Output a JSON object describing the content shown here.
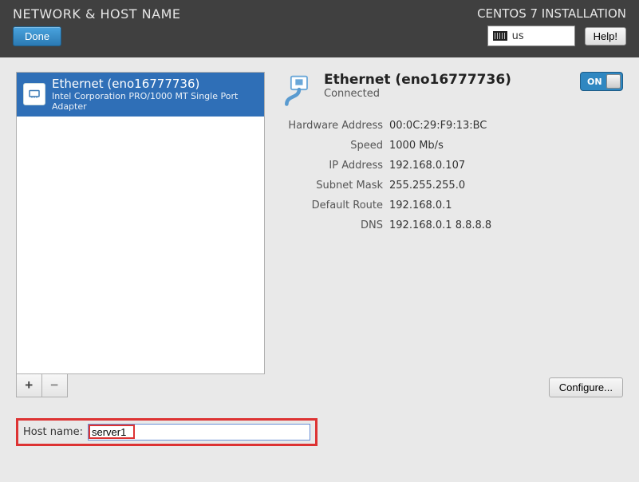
{
  "header": {
    "title": "NETWORK & HOST NAME",
    "done_label": "Done",
    "install_title": "CENTOS 7 INSTALLATION",
    "keyboard_layout": "us",
    "help_label": "Help!"
  },
  "interfaces": [
    {
      "name": "Ethernet (eno16777736)",
      "subtitle": "Intel Corporation PRO/1000 MT Single Port Adapter"
    }
  ],
  "buttons": {
    "add": "+",
    "remove": "−",
    "configure": "Configure..."
  },
  "detail": {
    "title": "Ethernet (eno16777736)",
    "status": "Connected",
    "toggle_state": "ON",
    "rows": {
      "hardware_address": {
        "label": "Hardware Address",
        "value": "00:0C:29:F9:13:BC"
      },
      "speed": {
        "label": "Speed",
        "value": "1000 Mb/s"
      },
      "ip_address": {
        "label": "IP Address",
        "value": "192.168.0.107"
      },
      "subnet_mask": {
        "label": "Subnet Mask",
        "value": "255.255.255.0"
      },
      "default_route": {
        "label": "Default Route",
        "value": "192.168.0.1"
      },
      "dns": {
        "label": "DNS",
        "value": "192.168.0.1 8.8.8.8"
      }
    }
  },
  "hostname": {
    "label": "Host name:",
    "value": "server1"
  }
}
